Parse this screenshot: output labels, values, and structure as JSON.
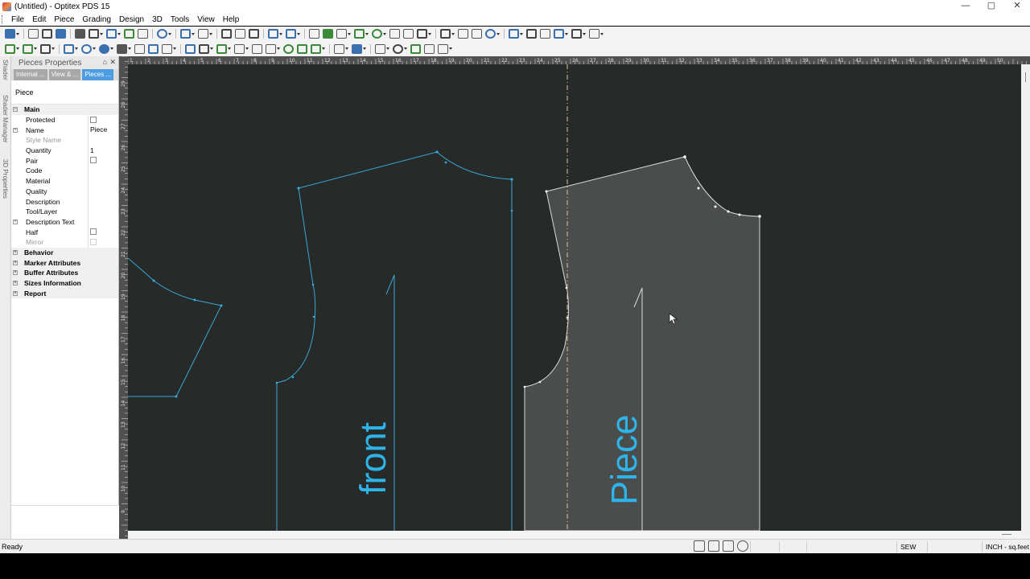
{
  "window": {
    "title": "(Untitled) - Optitex PDS 15",
    "controls": [
      "—",
      "▢",
      "✕"
    ]
  },
  "menu": [
    "File",
    "Edit",
    "Piece",
    "Grading",
    "Design",
    "3D",
    "Tools",
    "View",
    "Help"
  ],
  "side_tabs": [
    "Shader",
    "Shader Manager",
    "3D Properties"
  ],
  "panel": {
    "title": "Pieces Properties",
    "pin": "⌂",
    "close": "✕",
    "tabs": [
      "Internal ...",
      "View & ...",
      "Pieces ..."
    ],
    "active_tab": 2,
    "label": "Piece",
    "main_section": "Main",
    "properties": [
      {
        "name": "Protected",
        "type": "check",
        "value": ""
      },
      {
        "name": "Name",
        "type": "text",
        "value": "Piece",
        "expand": true
      },
      {
        "name": "Style Name",
        "type": "text",
        "value": "",
        "disabled": true
      },
      {
        "name": "Quantity",
        "type": "text",
        "value": "1"
      },
      {
        "name": "Pair",
        "type": "check",
        "value": ""
      },
      {
        "name": "Code",
        "type": "text",
        "value": ""
      },
      {
        "name": "Material",
        "type": "text",
        "value": ""
      },
      {
        "name": "Quality",
        "type": "text",
        "value": ""
      },
      {
        "name": "Description",
        "type": "text",
        "value": ""
      },
      {
        "name": "Tool/Layer",
        "type": "text",
        "value": ""
      },
      {
        "name": "Description Text",
        "type": "text",
        "value": "",
        "expand": true
      },
      {
        "name": "Half",
        "type": "check",
        "value": ""
      },
      {
        "name": "Mirror",
        "type": "check",
        "value": "",
        "disabled": true
      }
    ],
    "sections": [
      "Behavior",
      "Marker Attributes",
      "Buffer Attributes",
      "Sizes Information",
      "Report"
    ]
  },
  "canvas": {
    "background": "#262a28",
    "piece_labels": [
      "front",
      "Piece"
    ],
    "cursor": "arrow-cursor"
  },
  "ruler": {
    "h_labels": [
      "1",
      "2",
      "3",
      "4",
      "5",
      "6",
      "7",
      "8",
      "9",
      "10",
      "11",
      "12",
      "13",
      "14",
      "15",
      "16",
      "17",
      "18",
      "19",
      "20",
      "21",
      "22",
      "23",
      "24",
      "25",
      "26",
      "27",
      "28",
      "29",
      "30",
      "31",
      "32",
      "33",
      "34",
      "35",
      "36",
      "37",
      "38",
      "39",
      "40",
      "41",
      "42",
      "43",
      "44",
      "45",
      "46",
      "47",
      "48",
      "49",
      "50"
    ],
    "v_labels": [
      "29",
      "28",
      "27",
      "26",
      "25",
      "24",
      "23",
      "22",
      "21",
      "20",
      "19",
      "18",
      "17",
      "16",
      "15",
      "14",
      "13",
      "12",
      "11",
      "10",
      "9"
    ]
  },
  "status": {
    "text": "Ready",
    "mode": "SEW",
    "units": "INCH - sq.feet"
  },
  "colors": {
    "accent": "#2eb4e8",
    "piece_outline_blue": "#3aa8d8",
    "piece_selected_fill": "#4a4d4c",
    "panel_active_tab": "#4d9de0"
  }
}
